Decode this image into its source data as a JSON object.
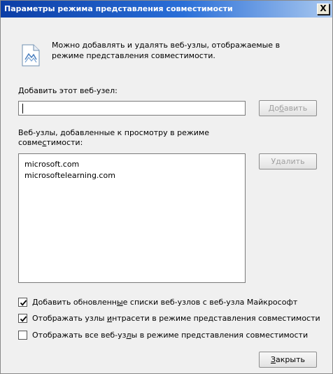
{
  "window": {
    "title": "Параметры режима представления совместимости",
    "close_glyph": "X"
  },
  "info": {
    "icon": "compatibility-view-icon",
    "text_line1": "Можно добавлять и удалять веб-узлы, отображаемые в",
    "text_line2": "режиме представления совместимости."
  },
  "add_site": {
    "label_u": "Д",
    "label_rest": "обавить этот веб-узел:",
    "value": "",
    "button_pre": "До",
    "button_u": "б",
    "button_post": "авить"
  },
  "list": {
    "label_line1": "Веб-узлы, добавленные к просмотру в режиме",
    "label_line2_pre": "совме",
    "label_line2_u": "с",
    "label_line2_post": "тимости:",
    "items": [
      "microsoft.com",
      "microsoftelearning.com"
    ],
    "remove_button": "Удалить"
  },
  "options": [
    {
      "checked": true,
      "pre": "Добавить обновленн",
      "u": "ы",
      "post": "е списки веб-узлов с веб-узла Майкрософт"
    },
    {
      "checked": true,
      "pre": "Отображать узлы ",
      "u": "и",
      "post": "нтрасети в режиме представления совместимости"
    },
    {
      "checked": false,
      "pre": "Отображать все веб-уз",
      "u": "л",
      "post": "ы в режиме представления совместимости"
    }
  ],
  "close_button": {
    "u": "З",
    "post": "акрыть"
  }
}
